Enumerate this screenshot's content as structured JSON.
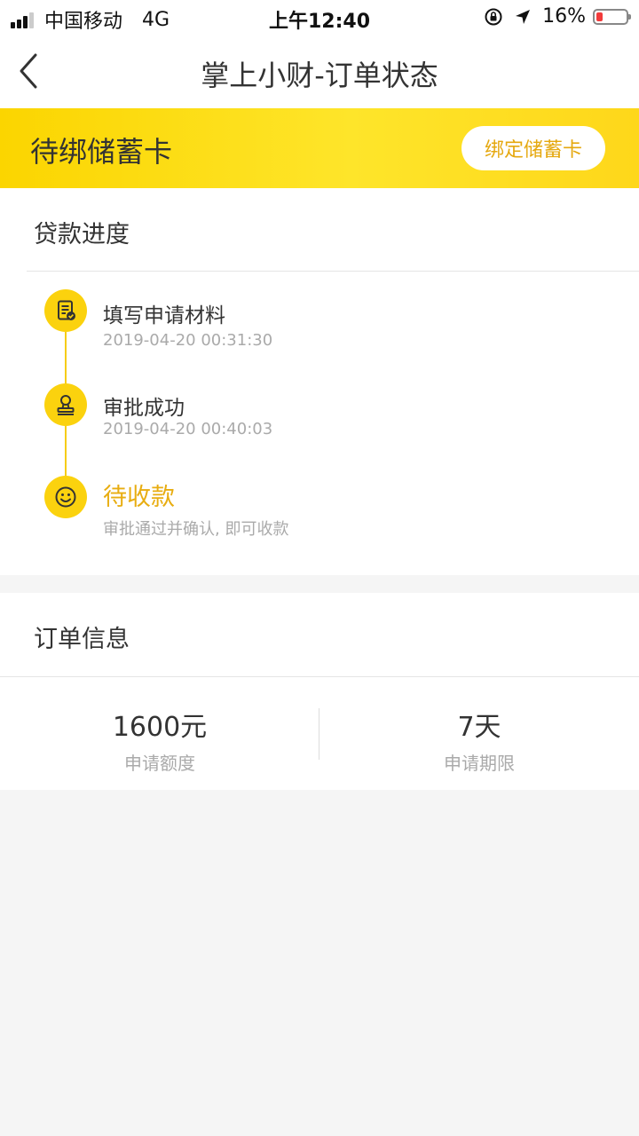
{
  "status_bar": {
    "carrier": "中国移动",
    "network": "4G",
    "time": "上午12:40",
    "battery": "16%"
  },
  "nav": {
    "title": "掌上小财-订单状态",
    "back_icon": "chevron-left-icon"
  },
  "banner": {
    "title": "待绑储蓄卡",
    "button_label": "绑定储蓄卡"
  },
  "progress": {
    "section_title": "贷款进度",
    "steps": [
      {
        "icon": "document-check-icon",
        "title": "填写申请材料",
        "subtitle": "2019-04-20 00:31:30"
      },
      {
        "icon": "stamp-icon",
        "title": "审批成功",
        "subtitle": "2019-04-20 00:40:03"
      },
      {
        "icon": "smiley-icon",
        "title": "待收款",
        "subtitle": "审批通过并确认, 即可收款"
      }
    ]
  },
  "order": {
    "section_title": "订单信息",
    "items": [
      {
        "value": "1600元",
        "label": "申请额度"
      },
      {
        "value": "7天",
        "label": "申请期限"
      }
    ]
  },
  "colors": {
    "accent_yellow": "#fbd20e",
    "accent_text": "#e8ad11",
    "background": "#f5f5f5"
  }
}
